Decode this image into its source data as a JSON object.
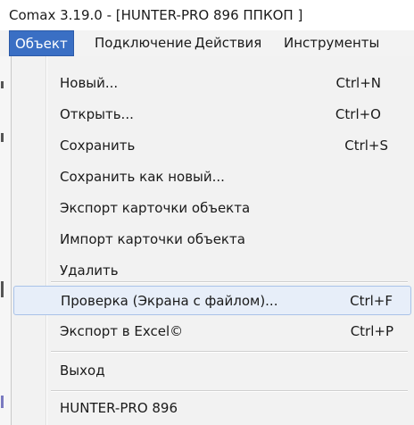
{
  "window": {
    "title": "Comax    3.19.0 - [HUNTER-PRO 896  ППКОП ]"
  },
  "menubar": {
    "items": [
      {
        "label": "Объект"
      },
      {
        "label": "Подключение"
      },
      {
        "label": "Действия"
      },
      {
        "label": "Инструменты"
      }
    ]
  },
  "menu": {
    "items": [
      {
        "label": "Новый...",
        "shortcut": "Ctrl+N"
      },
      {
        "label": "Открыть...",
        "shortcut": "Ctrl+O"
      },
      {
        "label": "Сохранить",
        "shortcut": "Ctrl+S"
      },
      {
        "label": "Сохранить как новый...",
        "shortcut": ""
      },
      {
        "label": "Экспорт карточки объекта",
        "shortcut": ""
      },
      {
        "label": "Импорт карточки объекта",
        "shortcut": ""
      },
      {
        "label": "Удалить",
        "shortcut": ""
      },
      {
        "label": "Проверка (Экрана с файлом)...",
        "shortcut": "Ctrl+F"
      },
      {
        "label": "Экспорт в Excel©",
        "shortcut": "Ctrl+P"
      },
      {
        "label": "Выход",
        "shortcut": ""
      },
      {
        "label": "HUNTER-PRO 896",
        "shortcut": ""
      }
    ],
    "highlighted": "Проверка (Экрана с файлом)..."
  },
  "colors": {
    "menu_active_bg": "#3a6fc4",
    "hover_bg": "#e7eef9",
    "hover_border": "#a9c2e8",
    "dropdown_bg": "#f2f2f2"
  }
}
